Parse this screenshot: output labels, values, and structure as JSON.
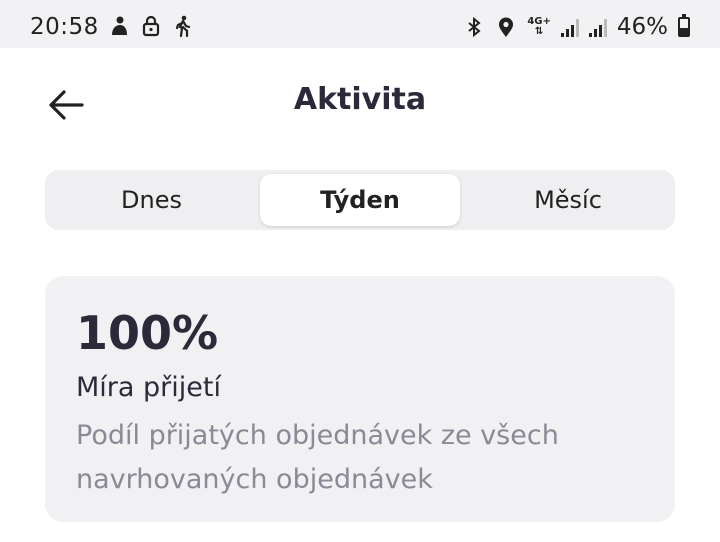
{
  "status_bar": {
    "time": "20:58",
    "left_icons": [
      "user-status-icon",
      "lock-icon",
      "walking-icon"
    ],
    "right_icons": [
      "bluetooth-icon",
      "location-icon",
      "network-4g-icon",
      "signal-icon",
      "signal-icon",
      "battery-icon"
    ],
    "network_label": "4G+",
    "battery_percent": "46%"
  },
  "header": {
    "back_icon": "arrow-left-icon",
    "title": "Aktivita"
  },
  "tabs": [
    {
      "label": "Dnes",
      "active": false
    },
    {
      "label": "Týden",
      "active": true
    },
    {
      "label": "Měsíc",
      "active": false
    }
  ],
  "card": {
    "value": "100%",
    "label": "Míra přijetí",
    "description": "Podíl přijatých objednávek ze všech navrhovaných objednávek"
  }
}
